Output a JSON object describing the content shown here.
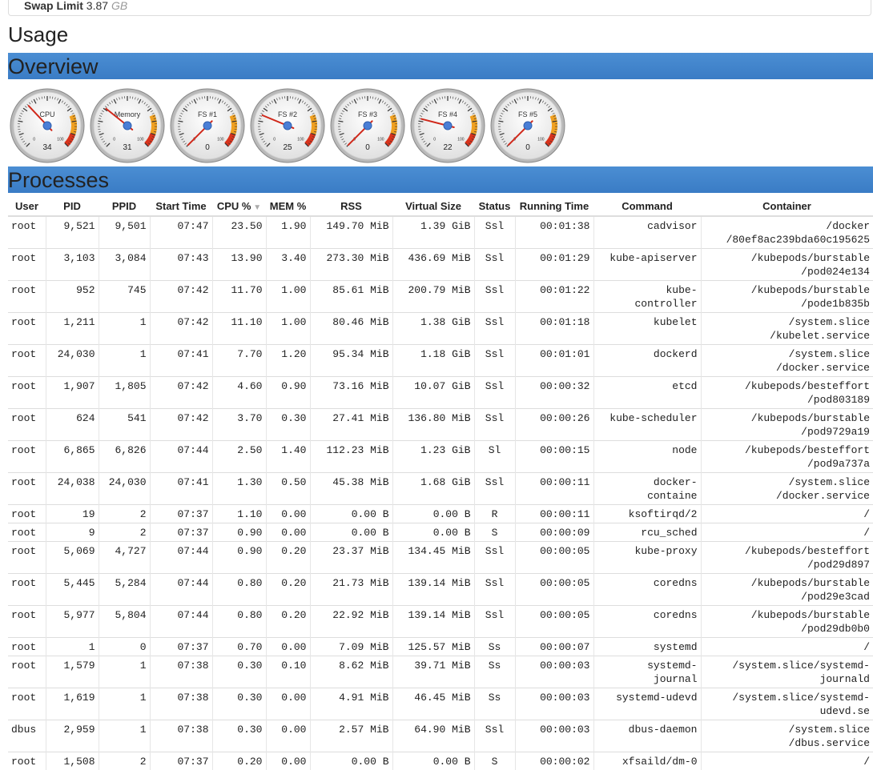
{
  "swap": {
    "label": "Swap Limit",
    "value": "3.87",
    "unit": "GB"
  },
  "usage_title": "Usage",
  "overview_title": "Overview",
  "processes_title": "Processes",
  "colors": {
    "section_bar": "#3a7cc5",
    "link": "#2a6ebb",
    "gauge_red": "#d9331c",
    "gauge_orange": "#f0a020"
  },
  "gauges": [
    {
      "label": "CPU",
      "value": 34
    },
    {
      "label": "Memory",
      "value": 31
    },
    {
      "label": "FS #1",
      "value": 0
    },
    {
      "label": "FS #2",
      "value": 25
    },
    {
      "label": "FS #3",
      "value": 0
    },
    {
      "label": "FS #4",
      "value": 22
    },
    {
      "label": "FS #5",
      "value": 0
    }
  ],
  "columns": [
    "User",
    "PID",
    "PPID",
    "Start Time",
    "CPU %",
    "MEM %",
    "RSS",
    "Virtual Size",
    "Status",
    "Running Time",
    "Command",
    "Container"
  ],
  "sort_icon": "sort-desc-icon",
  "rows": [
    [
      "root",
      "9,521",
      "9,501",
      "07:47",
      "23.50",
      "1.90",
      "149.70 MiB",
      "1.39 GiB",
      "Ssl",
      "00:01:38",
      "cadvisor",
      "/docker\n/80ef8ac239bda60c195625"
    ],
    [
      "root",
      "3,103",
      "3,084",
      "07:43",
      "13.90",
      "3.40",
      "273.30 MiB",
      "436.69 MiB",
      "Ssl",
      "00:01:29",
      "kube-apiserver",
      "/kubepods/burstable\n/pod024e134"
    ],
    [
      "root",
      "952",
      "745",
      "07:42",
      "11.70",
      "1.00",
      "85.61 MiB",
      "200.79 MiB",
      "Ssl",
      "00:01:22",
      "kube-\ncontroller",
      "/kubepods/burstable\n/pode1b835b"
    ],
    [
      "root",
      "1,211",
      "1",
      "07:42",
      "11.10",
      "1.00",
      "80.46 MiB",
      "1.38 GiB",
      "Ssl",
      "00:01:18",
      "kubelet",
      "/system.slice\n/kubelet.service"
    ],
    [
      "root",
      "24,030",
      "1",
      "07:41",
      "7.70",
      "1.20",
      "95.34 MiB",
      "1.18 GiB",
      "Ssl",
      "00:01:01",
      "dockerd",
      "/system.slice\n/docker.service"
    ],
    [
      "root",
      "1,907",
      "1,805",
      "07:42",
      "4.60",
      "0.90",
      "73.16 MiB",
      "10.07 GiB",
      "Ssl",
      "00:00:32",
      "etcd",
      "/kubepods/besteffort\n/pod803189"
    ],
    [
      "root",
      "624",
      "541",
      "07:42",
      "3.70",
      "0.30",
      "27.41 MiB",
      "136.80 MiB",
      "Ssl",
      "00:00:26",
      "kube-scheduler",
      "/kubepods/burstable\n/pod9729a19"
    ],
    [
      "root",
      "6,865",
      "6,826",
      "07:44",
      "2.50",
      "1.40",
      "112.23 MiB",
      "1.23 GiB",
      "Sl",
      "00:00:15",
      "node",
      "/kubepods/besteffort\n/pod9a737a"
    ],
    [
      "root",
      "24,038",
      "24,030",
      "07:41",
      "1.30",
      "0.50",
      "45.38 MiB",
      "1.68 GiB",
      "Ssl",
      "00:00:11",
      "docker-\ncontaine",
      "/system.slice\n/docker.service"
    ],
    [
      "root",
      "19",
      "2",
      "07:37",
      "1.10",
      "0.00",
      "0.00 B",
      "0.00 B",
      "R",
      "00:00:11",
      "ksoftirqd/2",
      "/"
    ],
    [
      "root",
      "9",
      "2",
      "07:37",
      "0.90",
      "0.00",
      "0.00 B",
      "0.00 B",
      "S",
      "00:00:09",
      "rcu_sched",
      "/"
    ],
    [
      "root",
      "5,069",
      "4,727",
      "07:44",
      "0.90",
      "0.20",
      "23.37 MiB",
      "134.45 MiB",
      "Ssl",
      "00:00:05",
      "kube-proxy",
      "/kubepods/besteffort\n/pod29d897"
    ],
    [
      "root",
      "5,445",
      "5,284",
      "07:44",
      "0.80",
      "0.20",
      "21.73 MiB",
      "139.14 MiB",
      "Ssl",
      "00:00:05",
      "coredns",
      "/kubepods/burstable\n/pod29e3cad"
    ],
    [
      "root",
      "5,977",
      "5,804",
      "07:44",
      "0.80",
      "0.20",
      "22.92 MiB",
      "139.14 MiB",
      "Ssl",
      "00:00:05",
      "coredns",
      "/kubepods/burstable\n/pod29db0b0"
    ],
    [
      "root",
      "1",
      "0",
      "07:37",
      "0.70",
      "0.00",
      "7.09 MiB",
      "125.57 MiB",
      "Ss",
      "00:00:07",
      "systemd",
      "/"
    ],
    [
      "root",
      "1,579",
      "1",
      "07:38",
      "0.30",
      "0.10",
      "8.62 MiB",
      "39.71 MiB",
      "Ss",
      "00:00:03",
      "systemd-\njournal",
      "/system.slice/systemd-\njournald"
    ],
    [
      "root",
      "1,619",
      "1",
      "07:38",
      "0.30",
      "0.00",
      "4.91 MiB",
      "46.45 MiB",
      "Ss",
      "00:00:03",
      "systemd-udevd",
      "/system.slice/systemd-\nudevd.se"
    ],
    [
      "dbus",
      "2,959",
      "1",
      "07:38",
      "0.30",
      "0.00",
      "2.57 MiB",
      "64.90 MiB",
      "Ssl",
      "00:00:03",
      "dbus-daemon",
      "/system.slice\n/dbus.service"
    ],
    [
      "root",
      "1,508",
      "2",
      "07:37",
      "0.20",
      "0.00",
      "0.00 B",
      "0.00 B",
      "S",
      "00:00:02",
      "xfsaild/dm-0",
      "/"
    ]
  ]
}
